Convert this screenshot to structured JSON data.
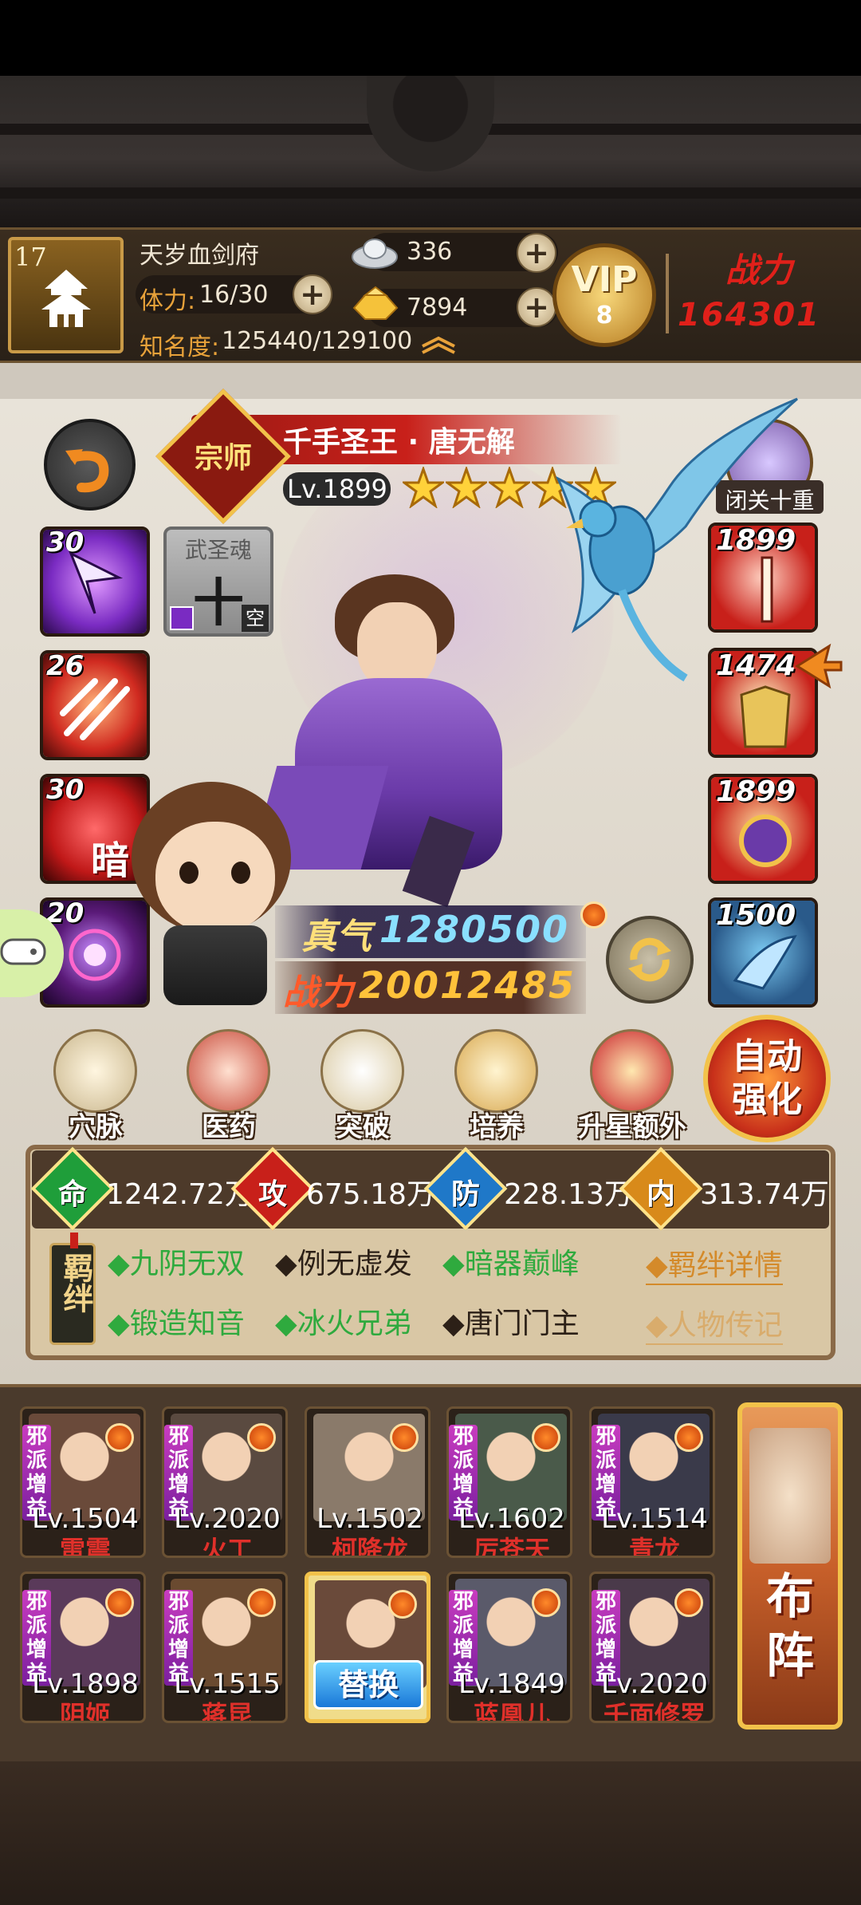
{
  "player": {
    "level": "17",
    "name": "天岁血剑府",
    "stamina_label": "体力:",
    "stamina_value": "16/30",
    "fame_label": "知名度:",
    "fame_value": "125440/129100",
    "silver": "336",
    "gold": "7894",
    "vip_label": "VIP",
    "vip_level": "8",
    "power_label": "战力",
    "power_value": "164301"
  },
  "hero": {
    "badge": "宗师",
    "title": "千手圣王 · 唐无解",
    "level": "Lv.1899",
    "stars": 5,
    "retreat_label": "闭关十重",
    "true_qi_label": "真气",
    "true_qi_value": "1280500",
    "combat_label": "战力",
    "combat_value": "20012485"
  },
  "skills_left": [
    {
      "level": "30",
      "color": "#7a2bc2"
    },
    {
      "level": "26",
      "color": "#d02a20"
    },
    {
      "level": "30",
      "color": "#c01818",
      "glyph": "暗"
    },
    {
      "level": "20",
      "color": "#5a1a78"
    }
  ],
  "soul_slot": {
    "title": "武圣魂",
    "value": "十",
    "tag": "空"
  },
  "equip_right": [
    {
      "level": "1899",
      "color": "#c8201a"
    },
    {
      "level": "1474",
      "color": "#c8201a"
    },
    {
      "level": "1899",
      "color": "#c8201a"
    },
    {
      "level": "1500",
      "color": "#b86a1a"
    }
  ],
  "functions": [
    {
      "label": "穴脉",
      "icon": "meridian-icon"
    },
    {
      "label": "医药",
      "icon": "medicine-icon"
    },
    {
      "label": "突破",
      "icon": "breakthrough-icon"
    },
    {
      "label": "培养",
      "icon": "train-icon"
    },
    {
      "label": "升星额外",
      "icon": "star-up-icon"
    }
  ],
  "auto_strengthen": "自动\n强化",
  "auto_line1": "自动",
  "auto_line2": "强化",
  "stats": [
    {
      "char": "命",
      "value": "1242.72万",
      "color": "#1f9e3a"
    },
    {
      "char": "攻",
      "value": "675.18万",
      "color": "#c8201a"
    },
    {
      "char": "防",
      "value": "228.13万",
      "color": "#1f78c8"
    },
    {
      "char": "内",
      "value": "313.74万",
      "color": "#d88a1a"
    }
  ],
  "bonds_label": "羁绊",
  "bonds": [
    {
      "text": "九阴无双",
      "active": true
    },
    {
      "text": "例无虚发",
      "active": false
    },
    {
      "text": "暗器巅峰",
      "active": true
    },
    {
      "text": "锻造知音",
      "active": true
    },
    {
      "text": "冰火兄弟",
      "active": true
    },
    {
      "text": "唐门门主",
      "active": false
    }
  ],
  "bond_details": "羁绊详情",
  "biography": "人物传记",
  "roster": [
    {
      "level": "Lv.1504",
      "name": "雷震",
      "tag": "邪派增益",
      "color": "#6a4a3a"
    },
    {
      "level": "Lv.2020",
      "name": "火工",
      "tag": "邪派增益",
      "color": "#5a4a40"
    },
    {
      "level": "Lv.1502",
      "name": "柯降龙",
      "tag": "",
      "color": "#8a7a6a"
    },
    {
      "level": "Lv.1602",
      "name": "厉苍天",
      "tag": "邪派增益",
      "color": "#4a5a4a"
    },
    {
      "level": "Lv.1514",
      "name": "青龙",
      "tag": "邪派增益",
      "color": "#3a3a4a"
    },
    {
      "level": "Lv.1898",
      "name": "阴姬",
      "tag": "邪派增益",
      "color": "#5a3a5a"
    },
    {
      "level": "Lv.1515",
      "name": "蒋昆",
      "tag": "邪派增益",
      "color": "#6a4a30"
    },
    {
      "level": "",
      "name": "",
      "tag": "",
      "color": "#6a4a3a"
    },
    {
      "level": "Lv.1849",
      "name": "蓝凰儿",
      "tag": "邪派增益",
      "color": "#5a5a6a"
    },
    {
      "level": "Lv.2020",
      "name": "千面修罗",
      "tag": "邪派增益",
      "color": "#4a3a4a"
    }
  ],
  "replace_label": "替换",
  "formation_line1": "布",
  "formation_line2": "阵"
}
